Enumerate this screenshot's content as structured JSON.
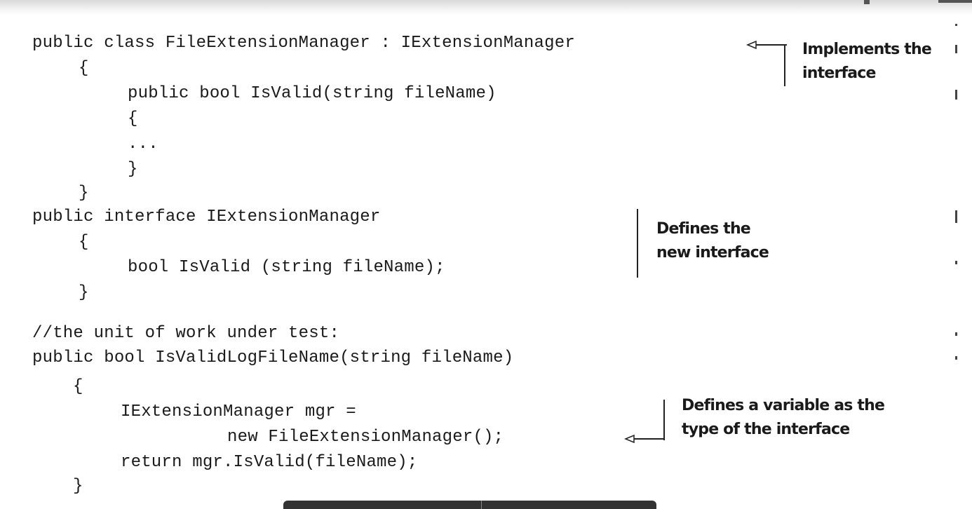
{
  "code": {
    "lines": [
      "public class FileExtensionManager : IExtensionManager",
      "{",
      "public bool IsValid(string fileName)",
      "{",
      "...",
      "}",
      "}",
      "public interface IExtensionManager",
      "{",
      "bool IsValid (string fileName);",
      "}",
      "//the unit of work under test:",
      "public bool IsValidLogFileName(string fileName)",
      "{",
      "IExtensionManager mgr =",
      "new FileExtensionManager();",
      "return mgr.IsValid(fileName);",
      "}"
    ]
  },
  "annotations": {
    "implements": [
      "Implements the",
      "interface"
    ],
    "defines_interface": [
      "Defines the",
      "new interface"
    ],
    "defines_variable": [
      "Defines a variable as the",
      "type of the interface"
    ]
  }
}
